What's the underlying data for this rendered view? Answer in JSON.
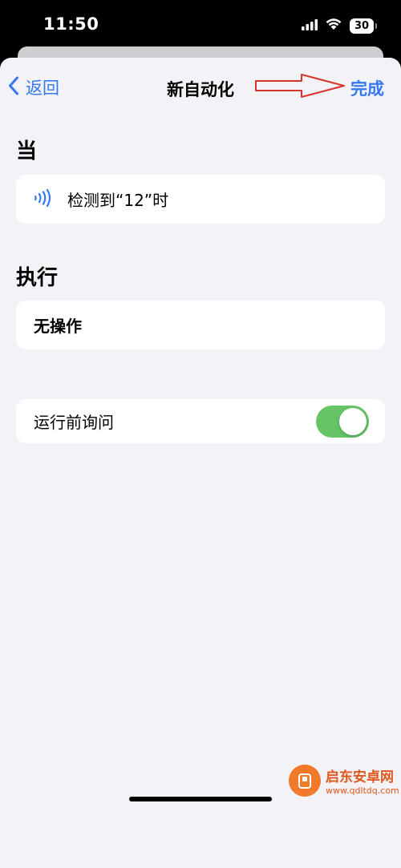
{
  "status_bar": {
    "time": "11:50",
    "battery": "30"
  },
  "nav": {
    "back_label": "返回",
    "title": "新自动化",
    "done_label": "完成"
  },
  "when_section": {
    "title": "当",
    "trigger": {
      "icon": "nfc-icon",
      "label": "检测到“12”时"
    }
  },
  "do_section": {
    "title": "执行",
    "action_label": "无操作"
  },
  "ask_before_running": {
    "label": "运行前询问",
    "enabled": true
  },
  "watermark": {
    "name": "启东安卓网",
    "url": "www.qdltdq.com"
  },
  "colors": {
    "accent": "#3478f6",
    "toggle_on": "#65c466",
    "annotation_arrow": "#d9332b",
    "background": "#f2f2f7"
  }
}
